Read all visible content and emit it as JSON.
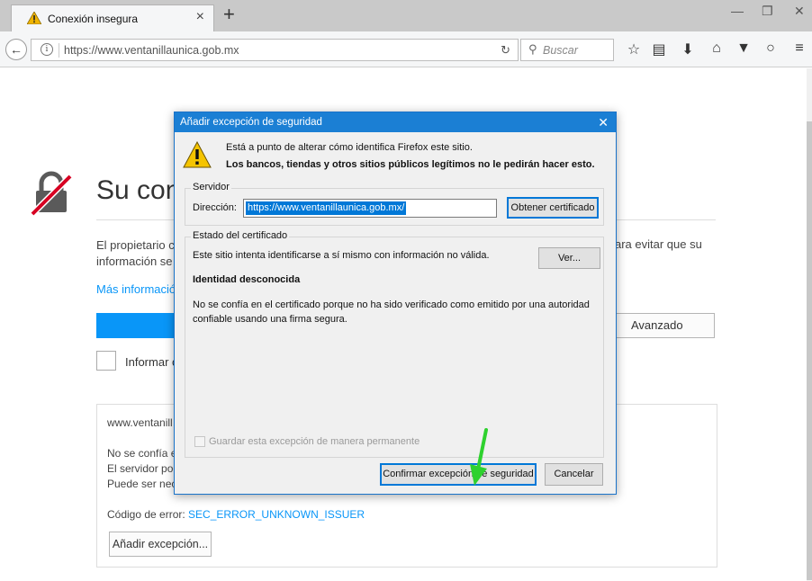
{
  "browser": {
    "tab_title": "Conexión insegura",
    "tab_close": "×",
    "new_tab": "+",
    "window_controls": [
      "—",
      "❐",
      "✕"
    ],
    "url": "https://www.ventanillaunica.gob.mx",
    "search_placeholder": "Buscar",
    "toolbar_icons": [
      "star-icon",
      "reading-list-icon",
      "download-icon",
      "home-icon",
      "pocket-icon",
      "chat-icon",
      "menu-icon"
    ]
  },
  "page": {
    "heading": "Su con",
    "para_left_1": "El propietario c",
    "para_left_2": "información se",
    "para_right_1": "ara evitar que su",
    "more_link": "Más informació",
    "advanced_button": "Avanzado",
    "report_label": "Informar c",
    "details": {
      "site": "www.ventanill",
      "line1": "No se confía e",
      "line2": "El servidor poc",
      "line3": "Puede ser nec",
      "error_prefix": "Código de error: ",
      "error_code": "SEC_ERROR_UNKNOWN_ISSUER",
      "add_exception_button": "Añadir excepción..."
    }
  },
  "dialog": {
    "title": "Añadir excepción de seguridad",
    "close": "✕",
    "warning_line1": "Está a punto de alterar cómo identifica Firefox este sitio.",
    "warning_line2": "Los bancos, tiendas y otros sitios públicos legítimos no le pedirán hacer esto.",
    "server_group": "Servidor",
    "address_label": "Dirección:",
    "address_value": "https://www.ventanillaunica.gob.mx/",
    "get_cert_button": "Obtener certificado",
    "cert_status_group": "Estado del certificado",
    "cert_status_text": "Este sitio intenta identificarse a sí mismo con información no válida.",
    "view_button": "Ver...",
    "unknown_identity": "Identidad desconocida",
    "untrusted_line1": "No se confía en el certificado porque no ha sido verificado como emitido por una autoridad",
    "untrusted_line2": "confiable usando una firma segura.",
    "permanent_label": "Guardar esta excepción de manera permanente",
    "confirm_button": "Confirmar excepción de seguridad",
    "cancel_button": "Cancelar"
  },
  "colors": {
    "accent_blue": "#0996f8",
    "titlebar_blue": "#1b7fd4",
    "annotation_arrow": "#2ed12e"
  }
}
